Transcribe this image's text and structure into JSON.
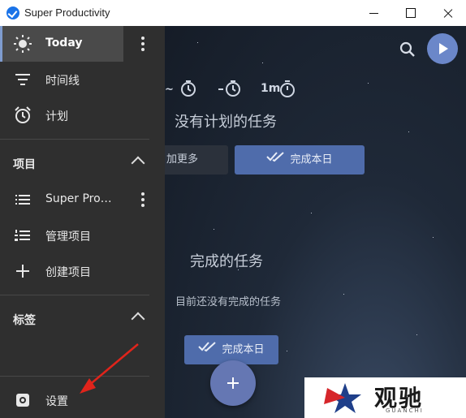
{
  "window": {
    "title": "Super Productivity"
  },
  "sidebar": {
    "items": [
      {
        "label": "Today",
        "icon": "sun-icon"
      },
      {
        "label": "时间线",
        "icon": "timeline-icon"
      },
      {
        "label": "计划",
        "icon": "alarm-icon"
      }
    ],
    "projects_header": "项目",
    "projects": [
      {
        "label": "Super Pro…",
        "icon": "list-icon"
      },
      {
        "label": "管理项目",
        "icon": "numbered-list-icon"
      },
      {
        "label": "创建项目",
        "icon": "plus-icon"
      }
    ],
    "tags_header": "标签",
    "settings_label": "设置"
  },
  "main": {
    "time_estimates": {
      "short_label": "1m"
    },
    "no_plan_title": "没有计划的任务",
    "add_more_label": "加更多",
    "finish_day_label": "完成本日",
    "done_title": "完成的任务",
    "done_empty": "目前还没有完成的任务",
    "finish_day_label_bottom": "完成本日"
  },
  "watermark": {
    "brand": "观驰",
    "sub": "GUANCHI"
  },
  "colors": {
    "accent": "#4f6cab",
    "sidebar": "#2f2f2f",
    "annotation": "#e0241b"
  }
}
